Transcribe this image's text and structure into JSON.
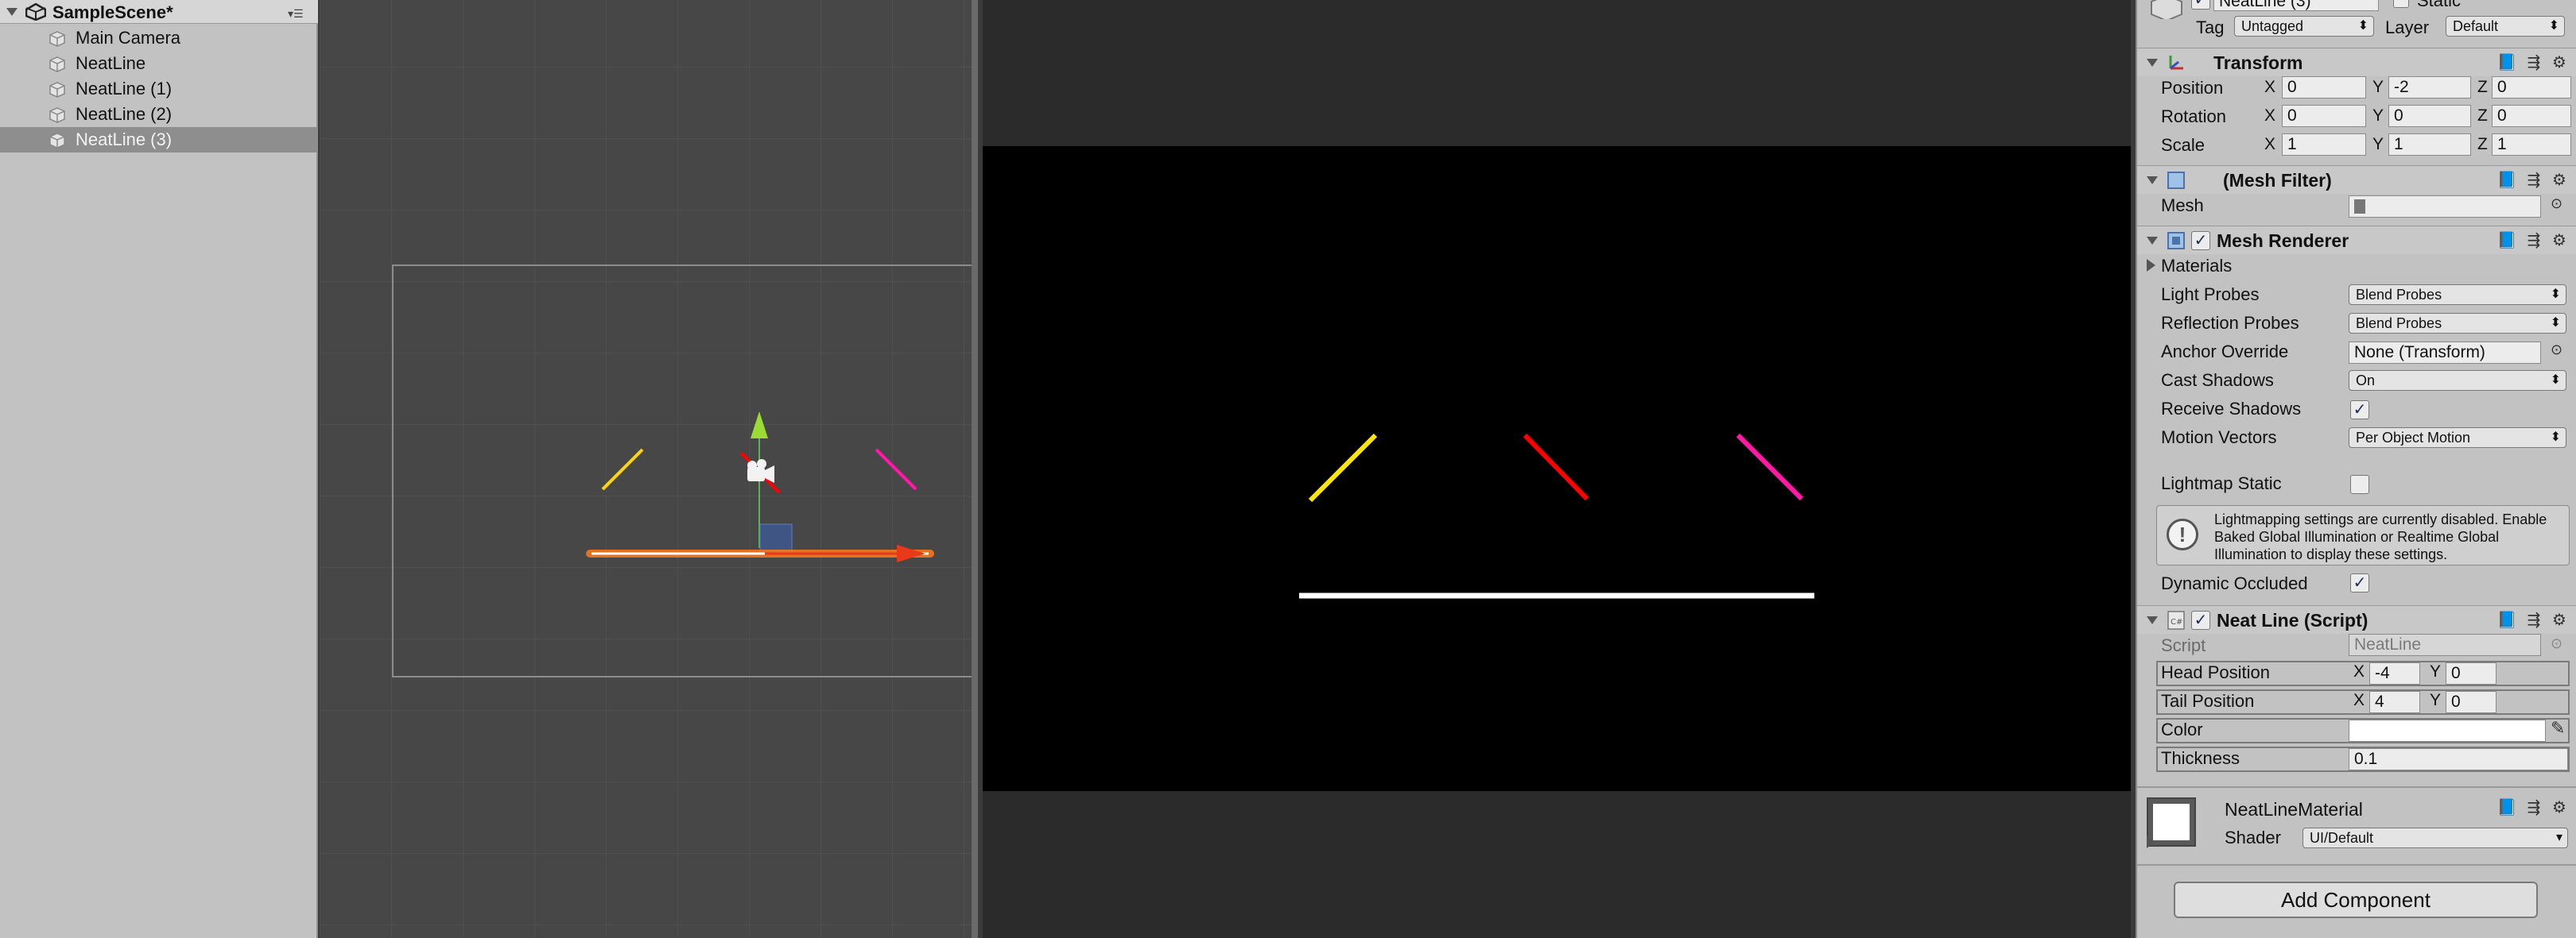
{
  "hierarchy": {
    "scene_name": "SampleScene*",
    "items": [
      {
        "label": "Main Camera"
      },
      {
        "label": "NeatLine"
      },
      {
        "label": "NeatLine (1)"
      },
      {
        "label": "NeatLine (2)"
      },
      {
        "label": "NeatLine (3)",
        "selected": true
      }
    ]
  },
  "game_view": {
    "lines": [
      {
        "color": "#ffe600"
      },
      {
        "color": "#ff0000"
      },
      {
        "color": "#ff1aa8"
      },
      {
        "color": "#ffffff"
      }
    ]
  },
  "inspector": {
    "header": {
      "name_value": "NeatLine (3)",
      "static_label": "Static",
      "tag_label": "Tag",
      "tag_value": "Untagged",
      "layer_label": "Layer",
      "layer_value": "Default"
    },
    "transform": {
      "title": "Transform",
      "position_label": "Position",
      "position": {
        "x": "0",
        "y": "-2",
        "z": "0"
      },
      "rotation_label": "Rotation",
      "rotation": {
        "x": "0",
        "y": "0",
        "z": "0"
      },
      "scale_label": "Scale",
      "scale": {
        "x": "1",
        "y": "1",
        "z": "1"
      }
    },
    "mesh_filter": {
      "title": "(Mesh Filter)",
      "mesh_label": "Mesh"
    },
    "mesh_renderer": {
      "title": "Mesh Renderer",
      "materials_label": "Materials",
      "light_probes_label": "Light Probes",
      "light_probes_value": "Blend Probes",
      "reflection_probes_label": "Reflection Probes",
      "reflection_probes_value": "Blend Probes",
      "anchor_override_label": "Anchor Override",
      "anchor_override_value": "None (Transform)",
      "cast_shadows_label": "Cast Shadows",
      "cast_shadows_value": "On",
      "receive_shadows_label": "Receive Shadows",
      "motion_vectors_label": "Motion Vectors",
      "motion_vectors_value": "Per Object Motion",
      "lightmap_static_label": "Lightmap Static",
      "help_text": "Lightmapping settings are currently disabled. Enable Baked Global Illumination or Realtime Global Illumination to display these settings.",
      "dynamic_occluded_label": "Dynamic Occluded"
    },
    "neat_line": {
      "title": "Neat Line (Script)",
      "script_label": "Script",
      "script_value": "NeatLine",
      "head_position_label": "Head Position",
      "head_position": {
        "x": "-4",
        "y": "0"
      },
      "tail_position_label": "Tail Position",
      "tail_position": {
        "x": "4",
        "y": "0"
      },
      "color_label": "Color",
      "color_value": "#ffffff",
      "thickness_label": "Thickness",
      "thickness_value": "0.1"
    },
    "material": {
      "name": "NeatLineMaterial",
      "shader_label": "Shader",
      "shader_value": "UI/Default"
    },
    "add_component_label": "Add Component"
  }
}
